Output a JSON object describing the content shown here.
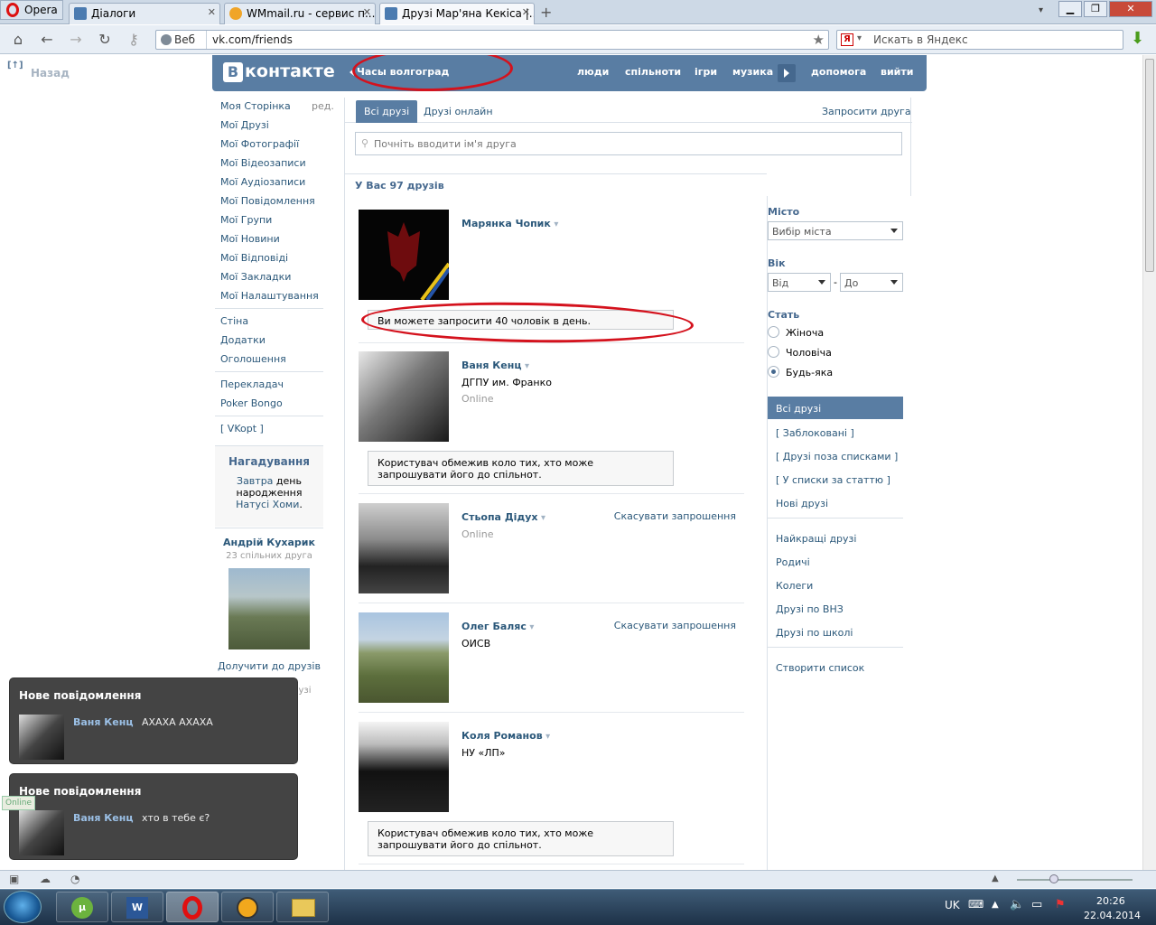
{
  "browser": {
    "menu_label": "Opera",
    "tabs": [
      {
        "label": "Діалоги"
      },
      {
        "label": "WMmail.ru - сервис п..."
      },
      {
        "label": "Друзі Мар'яна Кекіса |..."
      }
    ],
    "address_prefix": "Веб",
    "url": "vk.com/friends",
    "search_placeholder": "Искать в Яндекс",
    "yandex_letter": "Я"
  },
  "page": {
    "back_label": "Назад",
    "back_marker": "[↑]"
  },
  "vk": {
    "logo_text": "контакте",
    "logo_letter": "В",
    "status": "Часы волгоград",
    "nav": [
      "люди",
      "спільноти",
      "ігри",
      "музика",
      "допомога",
      "вийти"
    ],
    "left_menu": [
      "Моя Сторінка",
      "Мої Друзі",
      "Мої Фотографії",
      "Мої Відеозаписи",
      "Мої Аудіозаписи",
      "Мої Повідомлення",
      "Мої Групи",
      "Мої Новини",
      "Мої Відповіді",
      "Мої Закладки",
      "Мої Налаштування"
    ],
    "edit_label": "ред.",
    "extra_menu": [
      "Стіна",
      "Додатки",
      "Оголошення"
    ],
    "extra_menu2": [
      "Перекладач",
      "Poker Bongo"
    ],
    "vkopt": "[ VKopt ]",
    "reminder": {
      "title": "Нагадування",
      "p1": "Завтра",
      "p2": " день народження ",
      "p3": "Натусі Хоми",
      "p4": "."
    },
    "suggestion": {
      "name": "Андрій Кухарик",
      "common": "23 спільних друга",
      "add": "Долучити до друзів",
      "all": "Всі можливі друзі"
    },
    "tabs": {
      "all": "Всі друзі",
      "online": "Друзі онлайн",
      "invite": "Запросити друга"
    },
    "search_placeholder": "Почніть вводити ім'я друга",
    "friends_count": "У Вас 97 друзів",
    "friends": [
      {
        "name": "Марянка Чопик",
        "note": "Ви можете запросити 40 чоловік в день."
      },
      {
        "name": "Ваня Кенц",
        "sub": "ДГПУ им. Франко",
        "online": "Online",
        "note": "Користувач обмежив коло тих, хто може запрошувати його до спільнот."
      },
      {
        "name": "Стьопа Дідух",
        "online": "Online",
        "cancel": "Скасувати запрошення"
      },
      {
        "name": "Олег Баляс",
        "sub": "ОИСВ",
        "cancel": "Скасувати запрошення"
      },
      {
        "name": "Коля Романов",
        "sub": "НУ «ЛП»",
        "note": "Користувач обмежив коло тих, хто може запрошувати його до спільнот."
      }
    ],
    "filter": {
      "city_label": "Місто",
      "city_value": "Вибір міста",
      "age_label": "Вік",
      "age_from": "Від",
      "age_dash": "-",
      "age_to": "До",
      "sex_label": "Стать",
      "sex_options": [
        "Жіноча",
        "Чоловіча",
        "Будь-яка"
      ],
      "lists_a": [
        "Всі друзі",
        "[ Заблоковані ]",
        "[ Друзі поза списками ]",
        "[ У списки за статтю ]",
        "Нові друзі"
      ],
      "lists_b": [
        "Найкращі друзі",
        "Родичі",
        "Колеги",
        "Друзі по ВНЗ",
        "Друзі по школі"
      ],
      "create": "Створити список"
    }
  },
  "notifications": [
    {
      "title": "Нове повідомлення",
      "name": "Ваня Кенц",
      "text": "АХАХА АХАХА"
    },
    {
      "title": "Нове повідомлення",
      "name": "Ваня Кенц",
      "text": "хто в тебе є?"
    }
  ],
  "online_badge": "Online",
  "tray": {
    "lang": "UK",
    "time": "20:26",
    "date": "22.04.2014"
  },
  "colors": {
    "vk_blue": "#597da3",
    "link": "#2b587a",
    "annotation_red": "#d4121d"
  }
}
